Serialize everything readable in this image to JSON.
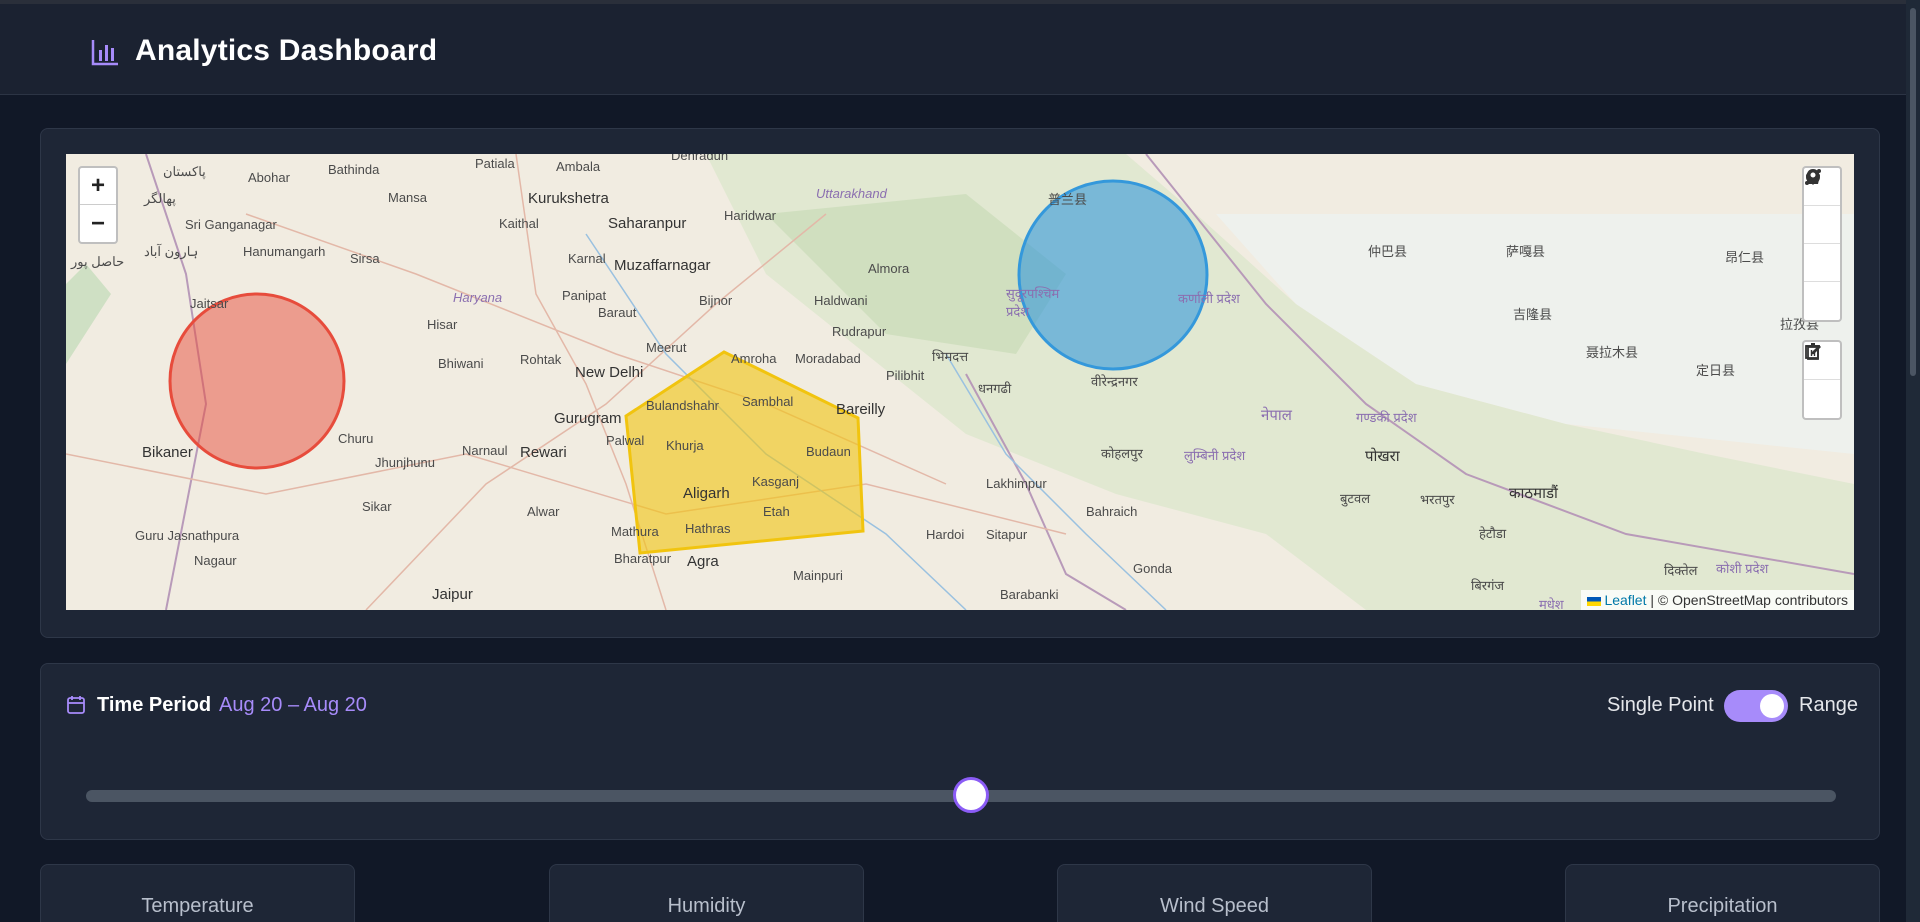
{
  "header": {
    "title": "Analytics Dashboard",
    "logo_icon": "bar-chart-icon"
  },
  "map": {
    "zoom_in_label": "+",
    "zoom_out_label": "−",
    "attribution_link": "Leaflet",
    "attribution_text": "| © OpenStreetMap contributors",
    "draw_tools": [
      "polyline-icon",
      "polygon-icon",
      "circle-icon",
      "marker-icon"
    ],
    "edit_tools": [
      "edit-icon",
      "trash-icon"
    ],
    "labels": {
      "l1": "پاکستان",
      "l2": "Bathinda",
      "l3": "Patiala",
      "l4": "Ambala",
      "l5": "Dehradun",
      "l6": "Abohar",
      "l7": "پھالگر",
      "l8": "Mansa",
      "l9": "Kurukshetra",
      "l10": "Haridwar",
      "l11": "Uttarakhand",
      "l12": "Sri Ganganagar",
      "l13": "Kaithal",
      "l14": "Saharanpur",
      "l15": "Hanumangarh",
      "l16": "ہارون آباد",
      "l17": "Sirsa",
      "l18": "Karnal",
      "l19": "Muzaffarnagar",
      "l20": "Almora",
      "l21": "حاصل پور",
      "l22": "Haryana",
      "l23": "Panipat",
      "l24": "Bijnor",
      "l25": "Haldwani",
      "l26": "Jaitsar",
      "l27": "Hisar",
      "l28": "Baraut",
      "l29": "Rudrapur",
      "l30": "Meerut",
      "l31": "Bhiwani",
      "l32": "Rohtak",
      "l33": "New Delhi",
      "l34": "Amroha",
      "l35": "Moradabad",
      "l36": "Pilibhit",
      "l37": "Gurugram",
      "l38": "Bulandshahr",
      "l39": "Sambhal",
      "l40": "Bareilly",
      "l41": "Churu",
      "l42": "Palwal",
      "l43": "Khurja",
      "l44": "Bikaner",
      "l45": "Narnaul",
      "l46": "Rewari",
      "l47": "Jhunjhunu",
      "l48": "Budaun",
      "l49": "Kasganj",
      "l50": "Aligarh",
      "l51": "Sikar",
      "l52": "Alwar",
      "l53": "Etah",
      "l54": "Guru Jasnathpura",
      "l55": "Mathura",
      "l56": "Hathras",
      "l57": "Hardoi",
      "l58": "Sitapur",
      "l59": "Nagaur",
      "l60": "Bharatpur",
      "l61": "Agra",
      "l62": "Mainpuri",
      "l63": "Jaipur",
      "l64": "Lakhimpur",
      "l65": "Barabanki",
      "l66": "Gonda",
      "l67": "Bahraich",
      "l68": "भिमदत्त",
      "l69": "धनगढी",
      "l70": "सुदूरपश्चिम प्रदेश",
      "l71": "कर्णाली प्रदेश",
      "l72": "वीरेन्द्रनगर",
      "l73": "नेपाल",
      "l74": "कोहलपुर",
      "l75": "लुम्बिनी प्रदेश",
      "l76": "गण्डकी प्रदेश",
      "l77": "पोखरा",
      "l78": "बुटवल",
      "l79": "भरतपुर",
      "l80": "काठमाडौं",
      "l81": "हेटौडा",
      "l82": "कोशी प्रदेश",
      "l83": "बिरगंज",
      "l84": "दिक्तेल",
      "l85": "仲巴县",
      "l86": "萨嘎县",
      "l87": "昂仁县",
      "l88": "吉隆县",
      "l89": "聂拉木县",
      "l90": "定日县",
      "l91": "拉孜县",
      "l92": "मधेश",
      "l93": "普兰县"
    }
  },
  "time_period": {
    "icon": "calendar-icon",
    "label": "Time Period",
    "range": "Aug 20 – Aug 20",
    "single_label": "Single Point",
    "range_label": "Range",
    "toggle_on": true,
    "slider_position": 0.5
  },
  "cards": [
    {
      "label": "Temperature"
    },
    {
      "label": "Humidity"
    },
    {
      "label": "Wind Speed"
    },
    {
      "label": "Precipitation"
    }
  ],
  "colors": {
    "accent": "#a78bfa",
    "red_zone": "#e74c3c",
    "blue_zone": "#3498db",
    "yellow_zone": "#f1c40f"
  }
}
